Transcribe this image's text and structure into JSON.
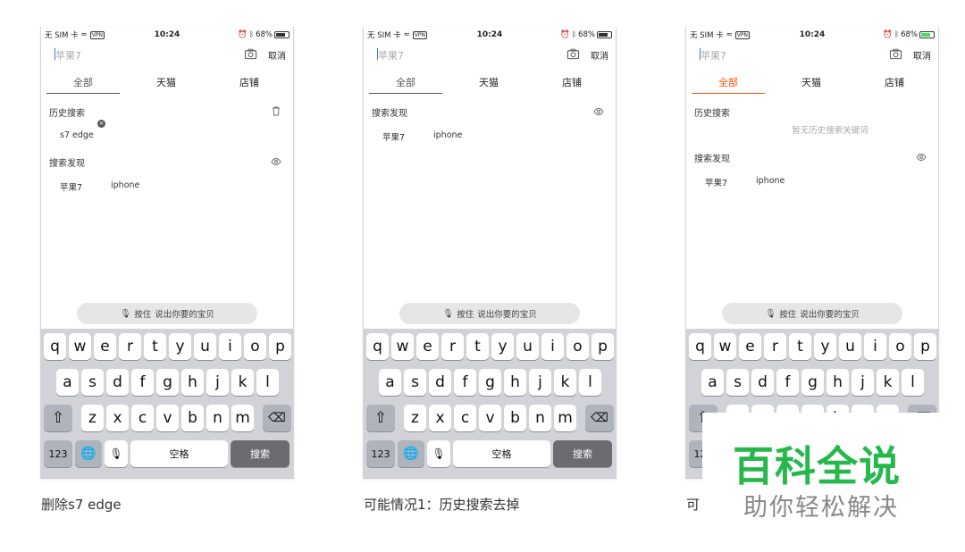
{
  "status": {
    "carrier": "无 SIM 卡",
    "vpn": "VPN",
    "time": "10:24",
    "battery": "68%"
  },
  "search": {
    "placeholder": "苹果7",
    "cancel": "取消"
  },
  "tabs": [
    "全部",
    "天猫",
    "店铺"
  ],
  "sections": {
    "history": "历史搜索",
    "discover": "搜索发现",
    "empty_history": "暂无历史搜索关键词"
  },
  "history_items": [
    "s7 edge"
  ],
  "discover_items": [
    "苹果7",
    "iphone"
  ],
  "voice_hint": {
    "label": "按住",
    "text": "说出你要的宝贝"
  },
  "keyboard": {
    "row1": [
      "q",
      "w",
      "e",
      "r",
      "t",
      "y",
      "u",
      "i",
      "o",
      "p"
    ],
    "row2": [
      "a",
      "s",
      "d",
      "f",
      "g",
      "h",
      "j",
      "k",
      "l"
    ],
    "row3": [
      "z",
      "x",
      "c",
      "v",
      "b",
      "n",
      "m"
    ],
    "numbers": "123",
    "space": "空格",
    "search": "搜索"
  },
  "captions": [
    "删除s7 edge",
    "可能情况1：历史搜索去掉",
    "可"
  ],
  "watermark": {
    "title": "百科全说",
    "subtitle": "助你轻松解决"
  },
  "colors": {
    "accent": "#ff5000",
    "watermark_green": "#27b84b"
  }
}
